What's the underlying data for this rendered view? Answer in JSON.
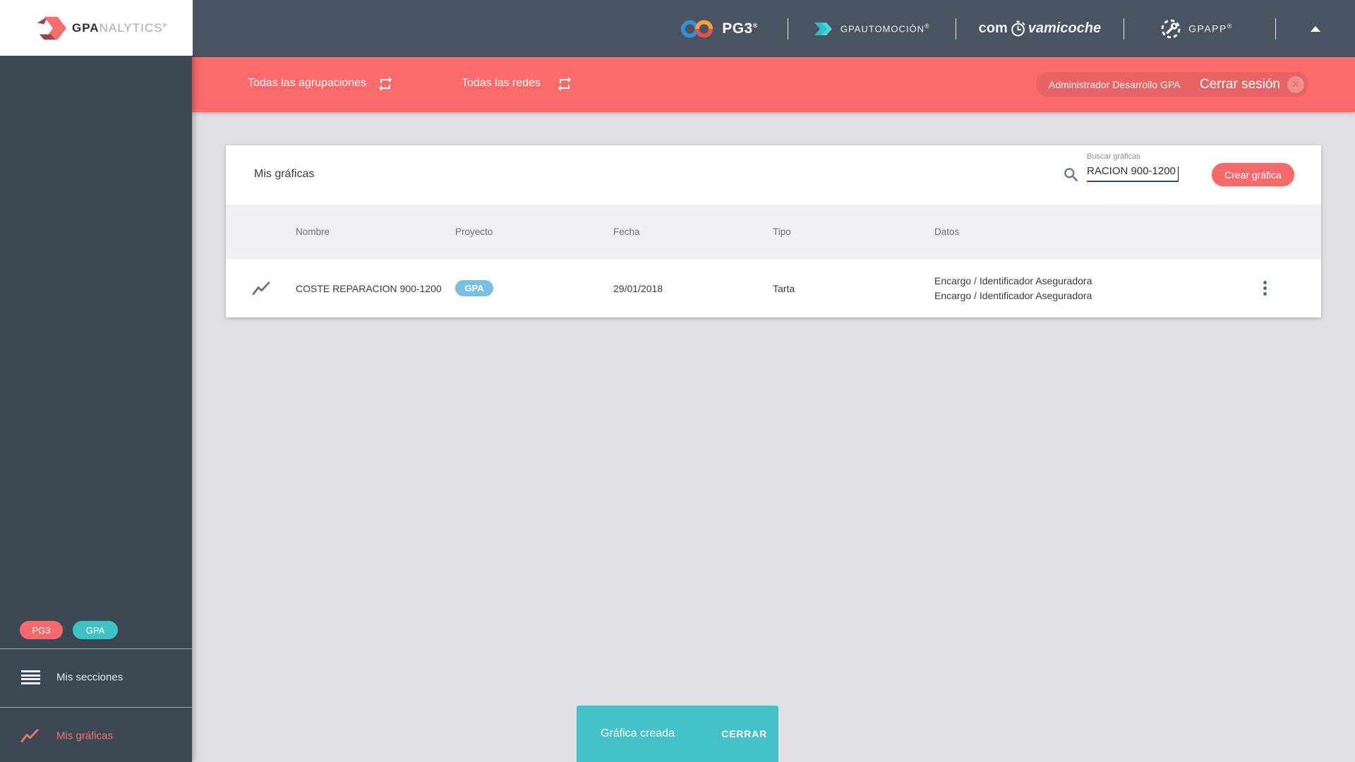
{
  "branding": {
    "analytics_logo": {
      "bold": "GPA",
      "light": "NALYTICS",
      "reg": "®"
    },
    "pg3": {
      "label": "PG3",
      "reg": "®"
    },
    "gpautomocion": {
      "label": "GPAUTOMOCIÓN",
      "reg": "®"
    },
    "compravamicoche": {
      "pre": "com",
      "post": "vamicoche"
    },
    "gpapp": {
      "label": "GPAPP",
      "reg": "®"
    }
  },
  "filter_bar": {
    "groupings_label": "Todas las agrupaciones",
    "networks_label": "Todas las redes",
    "user_name": "Administrador Desarrollo GPA",
    "logout_label": "Cerrar sesión",
    "logout_x": "✕"
  },
  "sidebar": {
    "badges": [
      {
        "label": "PG3"
      },
      {
        "label": "GPA"
      }
    ],
    "items": [
      {
        "label": "Mis secciones"
      },
      {
        "label": "Mis gráficas"
      }
    ]
  },
  "main": {
    "card_title": "Mis gráficas",
    "search": {
      "label": "Buscar gráficas",
      "value": "RACION 900-1200"
    },
    "create_button": "Crear gráfica",
    "table": {
      "headers": [
        "Nombre",
        "Proyecto",
        "Fecha",
        "Tipo",
        "Datos"
      ],
      "rows": [
        {
          "name": "COSTE REPARACION 900-1200",
          "project": "GPA",
          "date": "29/01/2018",
          "type": "Tarta",
          "data_lines": [
            "Encargo / Identificador Aseguradora",
            "Encargo / Identificador Aseguradora"
          ]
        }
      ]
    }
  },
  "toast": {
    "message": "Gráfica creada",
    "action": "CERRAR"
  },
  "colors": {
    "accent_salmon": "#fb6b6b",
    "button_salmon": "#f5696c",
    "teal": "#45c2c8",
    "badge_blue": "#7bbfe6",
    "header_slate": "#4a5362",
    "sidebar_slate": "#3b4854",
    "page_bg": "#e0e0e4",
    "table_head_bg": "#f0f0f3"
  }
}
